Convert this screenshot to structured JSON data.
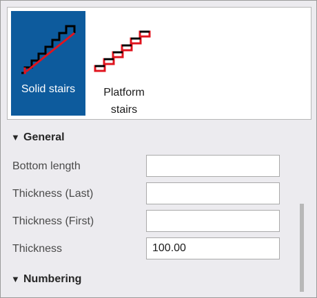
{
  "gallery": {
    "items": [
      {
        "label": "Solid stairs",
        "selected": true,
        "icon": "solid-stairs-icon"
      },
      {
        "label": "Platform stairs",
        "label_line1": "Platform",
        "label_line2": "stairs",
        "selected": false,
        "icon": "platform-stairs-icon"
      }
    ]
  },
  "sections": {
    "general": {
      "title": "General",
      "expander": "▼"
    },
    "numbering": {
      "title": "Numbering",
      "expander": "▼"
    }
  },
  "properties": {
    "bottom_length": {
      "label": "Bottom length",
      "value": ""
    },
    "thickness_last": {
      "label": "Thickness (Last)",
      "value": ""
    },
    "thickness_first": {
      "label": "Thickness (First)",
      "value": ""
    },
    "thickness": {
      "label": "Thickness",
      "value": "100.00"
    }
  },
  "colors": {
    "selected_tile": "#0d5b9d",
    "stair_red": "#e0141e",
    "panel_bg": "#ecebef"
  }
}
